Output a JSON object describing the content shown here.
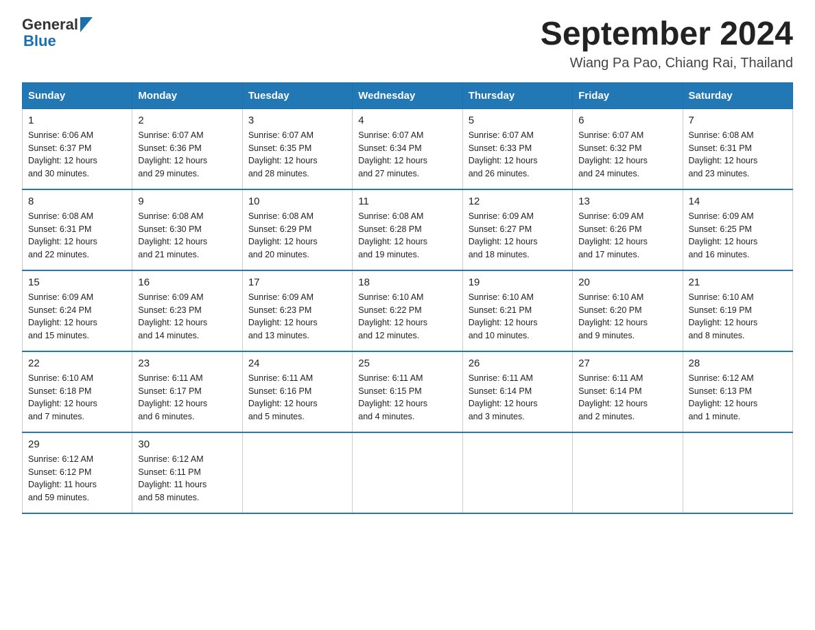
{
  "logo": {
    "text_general": "General",
    "text_blue": "Blue"
  },
  "header": {
    "month_title": "September 2024",
    "location": "Wiang Pa Pao, Chiang Rai, Thailand"
  },
  "days_of_week": [
    "Sunday",
    "Monday",
    "Tuesday",
    "Wednesday",
    "Thursday",
    "Friday",
    "Saturday"
  ],
  "weeks": [
    [
      {
        "day": "1",
        "sunrise": "6:06 AM",
        "sunset": "6:37 PM",
        "daylight": "12 hours and 30 minutes."
      },
      {
        "day": "2",
        "sunrise": "6:07 AM",
        "sunset": "6:36 PM",
        "daylight": "12 hours and 29 minutes."
      },
      {
        "day": "3",
        "sunrise": "6:07 AM",
        "sunset": "6:35 PM",
        "daylight": "12 hours and 28 minutes."
      },
      {
        "day": "4",
        "sunrise": "6:07 AM",
        "sunset": "6:34 PM",
        "daylight": "12 hours and 27 minutes."
      },
      {
        "day": "5",
        "sunrise": "6:07 AM",
        "sunset": "6:33 PM",
        "daylight": "12 hours and 26 minutes."
      },
      {
        "day": "6",
        "sunrise": "6:07 AM",
        "sunset": "6:32 PM",
        "daylight": "12 hours and 24 minutes."
      },
      {
        "day": "7",
        "sunrise": "6:08 AM",
        "sunset": "6:31 PM",
        "daylight": "12 hours and 23 minutes."
      }
    ],
    [
      {
        "day": "8",
        "sunrise": "6:08 AM",
        "sunset": "6:31 PM",
        "daylight": "12 hours and 22 minutes."
      },
      {
        "day": "9",
        "sunrise": "6:08 AM",
        "sunset": "6:30 PM",
        "daylight": "12 hours and 21 minutes."
      },
      {
        "day": "10",
        "sunrise": "6:08 AM",
        "sunset": "6:29 PM",
        "daylight": "12 hours and 20 minutes."
      },
      {
        "day": "11",
        "sunrise": "6:08 AM",
        "sunset": "6:28 PM",
        "daylight": "12 hours and 19 minutes."
      },
      {
        "day": "12",
        "sunrise": "6:09 AM",
        "sunset": "6:27 PM",
        "daylight": "12 hours and 18 minutes."
      },
      {
        "day": "13",
        "sunrise": "6:09 AM",
        "sunset": "6:26 PM",
        "daylight": "12 hours and 17 minutes."
      },
      {
        "day": "14",
        "sunrise": "6:09 AM",
        "sunset": "6:25 PM",
        "daylight": "12 hours and 16 minutes."
      }
    ],
    [
      {
        "day": "15",
        "sunrise": "6:09 AM",
        "sunset": "6:24 PM",
        "daylight": "12 hours and 15 minutes."
      },
      {
        "day": "16",
        "sunrise": "6:09 AM",
        "sunset": "6:23 PM",
        "daylight": "12 hours and 14 minutes."
      },
      {
        "day": "17",
        "sunrise": "6:09 AM",
        "sunset": "6:23 PM",
        "daylight": "12 hours and 13 minutes."
      },
      {
        "day": "18",
        "sunrise": "6:10 AM",
        "sunset": "6:22 PM",
        "daylight": "12 hours and 12 minutes."
      },
      {
        "day": "19",
        "sunrise": "6:10 AM",
        "sunset": "6:21 PM",
        "daylight": "12 hours and 10 minutes."
      },
      {
        "day": "20",
        "sunrise": "6:10 AM",
        "sunset": "6:20 PM",
        "daylight": "12 hours and 9 minutes."
      },
      {
        "day": "21",
        "sunrise": "6:10 AM",
        "sunset": "6:19 PM",
        "daylight": "12 hours and 8 minutes."
      }
    ],
    [
      {
        "day": "22",
        "sunrise": "6:10 AM",
        "sunset": "6:18 PM",
        "daylight": "12 hours and 7 minutes."
      },
      {
        "day": "23",
        "sunrise": "6:11 AM",
        "sunset": "6:17 PM",
        "daylight": "12 hours and 6 minutes."
      },
      {
        "day": "24",
        "sunrise": "6:11 AM",
        "sunset": "6:16 PM",
        "daylight": "12 hours and 5 minutes."
      },
      {
        "day": "25",
        "sunrise": "6:11 AM",
        "sunset": "6:15 PM",
        "daylight": "12 hours and 4 minutes."
      },
      {
        "day": "26",
        "sunrise": "6:11 AM",
        "sunset": "6:14 PM",
        "daylight": "12 hours and 3 minutes."
      },
      {
        "day": "27",
        "sunrise": "6:11 AM",
        "sunset": "6:14 PM",
        "daylight": "12 hours and 2 minutes."
      },
      {
        "day": "28",
        "sunrise": "6:12 AM",
        "sunset": "6:13 PM",
        "daylight": "12 hours and 1 minute."
      }
    ],
    [
      {
        "day": "29",
        "sunrise": "6:12 AM",
        "sunset": "6:12 PM",
        "daylight": "11 hours and 59 minutes."
      },
      {
        "day": "30",
        "sunrise": "6:12 AM",
        "sunset": "6:11 PM",
        "daylight": "11 hours and 58 minutes."
      },
      null,
      null,
      null,
      null,
      null
    ]
  ],
  "labels": {
    "sunrise": "Sunrise:",
    "sunset": "Sunset:",
    "daylight": "Daylight:"
  }
}
